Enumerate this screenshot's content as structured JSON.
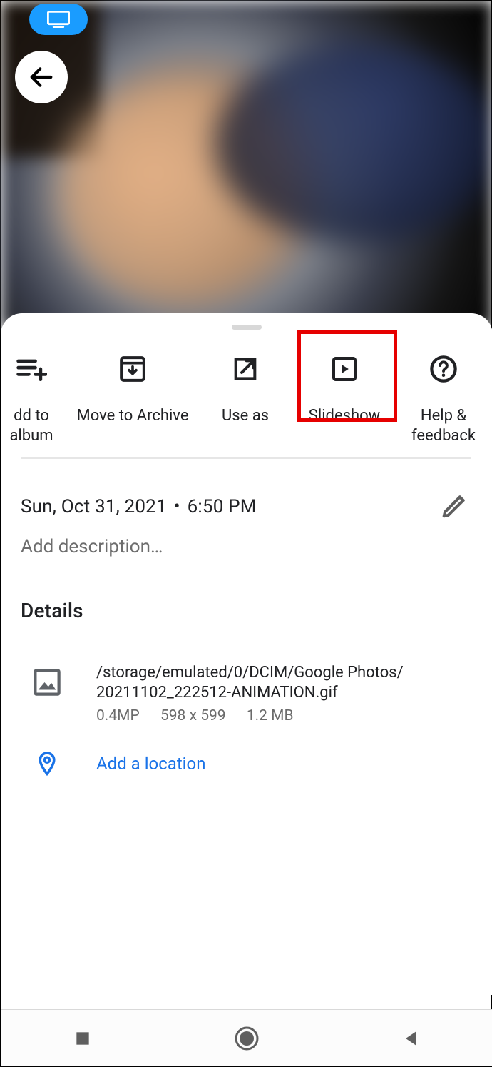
{
  "actions": {
    "add_to_album": "dd to album",
    "move_to_archive": "Move to Archive",
    "use_as": "Use as",
    "slideshow": "Slideshow",
    "help_feedback": "Help &\nfeedback"
  },
  "datetime": {
    "date": "Sun, Oct 31, 2021",
    "time": "6:50 PM"
  },
  "description_placeholder": "Add description…",
  "details": {
    "heading": "Details",
    "file_path_line1": "/storage/emulated/0/DCIM/Google Photos/",
    "file_path_line2": "20211102_222512-ANIMATION.gif",
    "megapixels": "0.4MP",
    "dimensions": "598 x 599",
    "filesize": "1.2 MB"
  },
  "location": {
    "add_label": "Add a location"
  }
}
